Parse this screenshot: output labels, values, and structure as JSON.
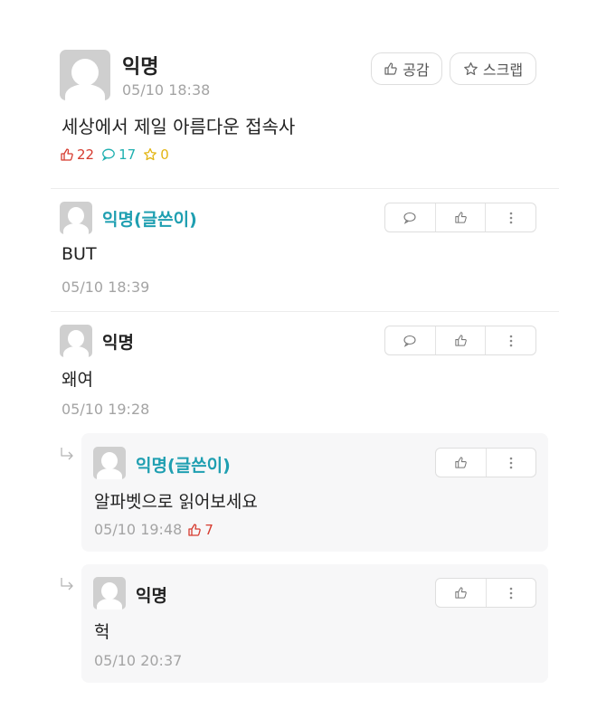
{
  "post": {
    "author": "익명",
    "time": "05/10 18:38",
    "body": "세상에서 제일 아름다운 접속사",
    "like_button": "공감",
    "scrap_button": "스크랩",
    "likes": "22",
    "comments": "17",
    "scraps": "0"
  },
  "comments": [
    {
      "author": "익명(글쓴이)",
      "text": "BUT",
      "time": "05/10 18:39"
    },
    {
      "author": "익명",
      "text": "왜여",
      "time": "05/10 19:28"
    }
  ],
  "replies": [
    {
      "author": "익명(글쓴이)",
      "text": "알파벳으로 읽어보세요",
      "time": "05/10 19:48",
      "likes": "7"
    },
    {
      "author": "익명",
      "text": "헉",
      "time": "05/10 20:37"
    }
  ],
  "colors": {
    "writer": "#1f9fb1",
    "like": "#d63b2f",
    "comment": "#1fb0b0",
    "scrap": "#e3b514",
    "muted": "#a4a4a4"
  }
}
